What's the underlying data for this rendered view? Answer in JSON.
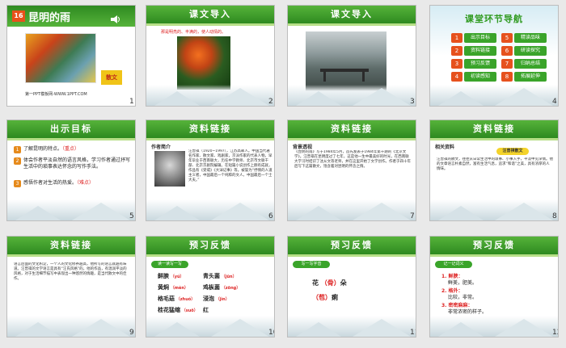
{
  "slides": [
    {
      "num": "1",
      "title": "昆明的雨",
      "lesson_num": "16",
      "badge": "散文",
      "footer": "第一PPT模板网-WWW.1PPT.COM"
    },
    {
      "num": "2",
      "title": "课文导入",
      "caption": "那是明亮的、丰满的，使人动情的。"
    },
    {
      "num": "3",
      "title": "课文导入"
    },
    {
      "num": "4",
      "title": "课堂环节导航",
      "items": [
        {
          "n": "1",
          "label": "出示目标"
        },
        {
          "n": "5",
          "label": "精读品味"
        },
        {
          "n": "2",
          "label": "资料链接"
        },
        {
          "n": "6",
          "label": "研读探究"
        },
        {
          "n": "3",
          "label": "预习反馈"
        },
        {
          "n": "7",
          "label": "归纳总结"
        },
        {
          "n": "4",
          "label": "初读感知"
        },
        {
          "n": "8",
          "label": "拓展延伸"
        }
      ]
    },
    {
      "num": "5",
      "title": "出示目标",
      "goals": [
        {
          "n": "1",
          "text": "了解昆明的特点。",
          "mark": "（重点）"
        },
        {
          "n": "2",
          "text": "体会作者平淡自然的语言风格，学习作者通过抒写生活中的琐事表达怀念的写作手法。",
          "mark": ""
        },
        {
          "n": "3",
          "text": "感悟作者对生活的热爱。",
          "mark": "（难点）"
        }
      ]
    },
    {
      "num": "6",
      "title": "资料链接",
      "subtitle": "作者简介",
      "body": "汪曾祺（1920~1997），江苏高邮人。中国当代著名作家、散文家、戏剧家，京派作家的代表人物。早年毕业于西南联大，历任中学教师、北京市文联干部、北京京剧院编辑。在短篇小说创作上颇有成就，作品有《受戒》《大淖记事》等。被誉为“抒情的人道主义者，中国最后一个纯粹的文人，中国最后一个士大夫。”",
      "highlight": "抒情的人道主义者，中国最后一个纯粹的文人"
    },
    {
      "num": "7",
      "title": "资料链接",
      "subtitle": "背景透视",
      "body": "《昆明的雨》写于1984年5月，首先发表于1984年第十期的《北京文学》。汪曾祺在昆明度过了七年，这是他一生中最美好的时光，在西南联大学习时结识了沈从文等老师，并在这里开始了文学创作。作者于四十年后写下这篇散文，饱含着对昆明的怀念之情。"
    },
    {
      "num": "8",
      "title": "资料链接",
      "subtitle": "相关资料",
      "tag": "汪曾祺散文",
      "body": "汪曾祺的散文，往往从日常生活中的琐事、小事入手，平淡中见深情。他的文章语言朴素自然，富有生活气息，追求“和谐”之美，具有浓厚的人情味。"
    },
    {
      "num": "9",
      "title": "资料链接",
      "body": "语言后面的文化积淀，一个人的文化修养越高，他所写的语言就越有味道。汪曾祺的文学语言是具有“汪氏风格”的。他的作品，有温润平淡的风格，对于生活细节描写中表现出一种悠然的情趣，是当代散文中的佳作。"
    },
    {
      "num": "10",
      "title": "预习反馈",
      "section": "读一读写一写",
      "words": [
        {
          "w": "鲜腴",
          "p": "yú"
        },
        {
          "w": "青头菌",
          "p": "jūn"
        },
        {
          "w": "黄焖",
          "p": "mèn"
        },
        {
          "w": "鸡枞菌",
          "p": "zōng"
        },
        {
          "w": "格毛菇",
          "p": "zhuó"
        },
        {
          "w": "浸泡",
          "p": "jìn"
        },
        {
          "w": "桂花猛缩",
          "p": "suō"
        },
        {
          "w": "红",
          "p": ""
        }
      ]
    },
    {
      "num": "11",
      "title": "预习反馈",
      "section": "写一写字音",
      "chars": [
        {
          "w": "花",
          "p": "骨",
          "tail": "朵"
        },
        {
          "w": "",
          "p": "苞",
          "tail": "痢"
        }
      ]
    },
    {
      "num": "12",
      "title": "预习反馈",
      "section": "记一记词义",
      "entries": [
        {
          "term": "1. 鲜腴：",
          "def": "鲜美，肥美。"
        },
        {
          "term": "2. 格外：",
          "def": "比较，非常。"
        },
        {
          "term": "3. 密密麻麻：",
          "def": "非常浓密的样子。"
        }
      ]
    }
  ]
}
